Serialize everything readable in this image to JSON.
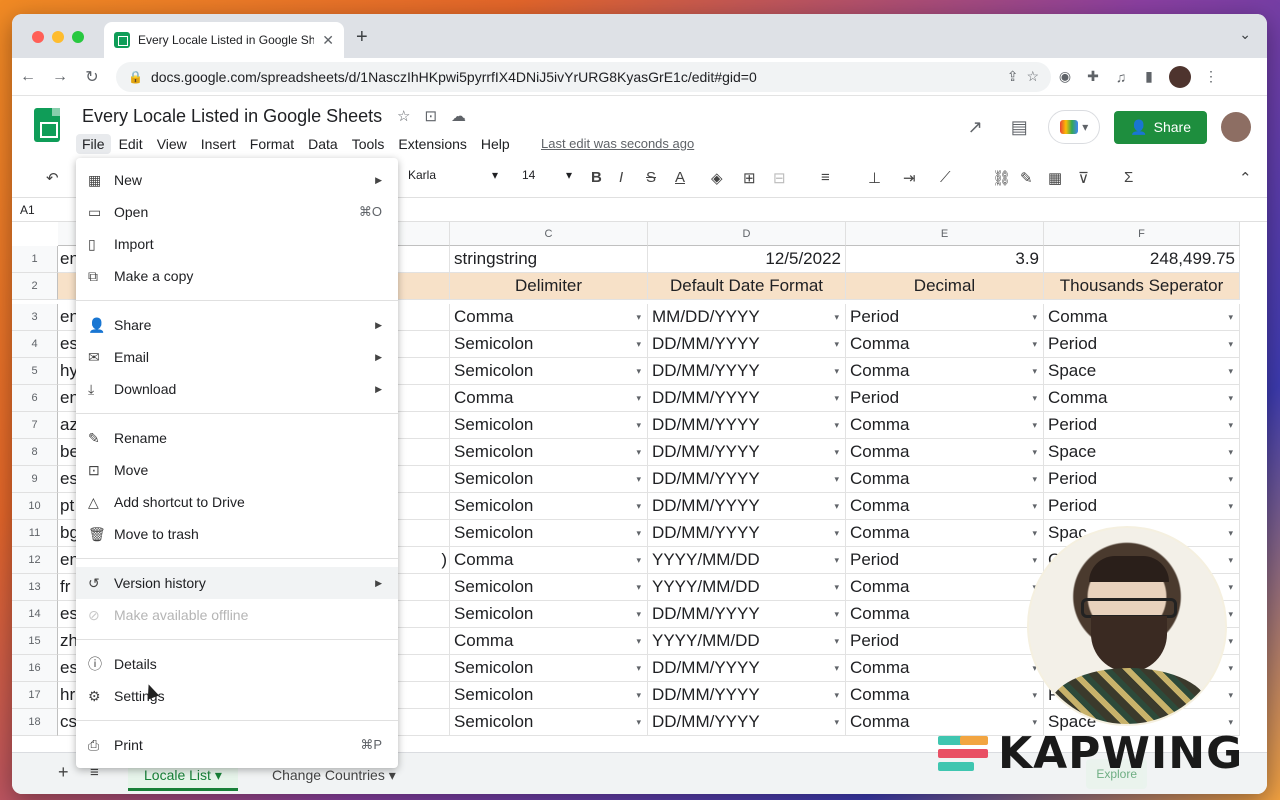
{
  "browser": {
    "tab_title": "Every Locale Listed in Google Sheets",
    "new_tab": "+",
    "url": "docs.google.com/spreadsheets/d/1NasczIhHKpwi5pyrrfIX4DNiJ5ivYrURG8KyasGrE1c/edit#gid=0"
  },
  "doc": {
    "title": "Every Locale Listed in Google Sheets",
    "menu": [
      "File",
      "Edit",
      "View",
      "Insert",
      "Format",
      "Data",
      "Tools",
      "Extensions",
      "Help"
    ],
    "last_edit": "Last edit was seconds ago",
    "share_label": "Share"
  },
  "toolbar": {
    "font": "Karla",
    "font_size": "14"
  },
  "formula_bar": {
    "cell_ref": "A1"
  },
  "grid": {
    "columns": [
      "C",
      "D",
      "E",
      "F"
    ],
    "row_numbers": [
      "1",
      "2",
      "3",
      "4",
      "5",
      "6",
      "7",
      "8",
      "9",
      "10",
      "11",
      "12",
      "13",
      "14",
      "15",
      "16",
      "17",
      "18"
    ],
    "col_a_partial": [
      "en",
      "",
      "en",
      "es",
      "hy",
      "en",
      "az",
      "be",
      "es",
      "pt",
      "bg",
      "en",
      "fr",
      "es",
      "zh",
      "es",
      "hr",
      "cs"
    ],
    "col_b_partial_row12": ")",
    "row1": {
      "c": "stringstring",
      "d": "12/5/2022",
      "e": "3.9",
      "f": "248,499.75"
    },
    "row2": {
      "c": "Delimiter",
      "d": "Default Date Format",
      "e": "Decimal",
      "f": "Thousands Seperator"
    },
    "rows": [
      {
        "c": "Comma",
        "d": "MM/DD/YYYY",
        "e": "Period",
        "f": "Comma"
      },
      {
        "c": "Semicolon",
        "d": "DD/MM/YYYY",
        "e": "Comma",
        "f": "Period"
      },
      {
        "c": "Semicolon",
        "d": "DD/MM/YYYY",
        "e": "Comma",
        "f": "Space"
      },
      {
        "c": "Comma",
        "d": "DD/MM/YYYY",
        "e": "Period",
        "f": "Comma"
      },
      {
        "c": "Semicolon",
        "d": "DD/MM/YYYY",
        "e": "Comma",
        "f": "Period"
      },
      {
        "c": "Semicolon",
        "d": "DD/MM/YYYY",
        "e": "Comma",
        "f": "Space"
      },
      {
        "c": "Semicolon",
        "d": "DD/MM/YYYY",
        "e": "Comma",
        "f": "Period"
      },
      {
        "c": "Semicolon",
        "d": "DD/MM/YYYY",
        "e": "Comma",
        "f": "Period"
      },
      {
        "c": "Semicolon",
        "d": "DD/MM/YYYY",
        "e": "Comma",
        "f": "Spac"
      },
      {
        "c": "Comma",
        "d": "YYYY/MM/DD",
        "e": "Period",
        "f": "C"
      },
      {
        "c": "Semicolon",
        "d": "YYYY/MM/DD",
        "e": "Comma",
        "f": ""
      },
      {
        "c": "Semicolon",
        "d": "DD/MM/YYYY",
        "e": "Comma",
        "f": ""
      },
      {
        "c": "Comma",
        "d": "YYYY/MM/DD",
        "e": "Period",
        "f": ""
      },
      {
        "c": "Semicolon",
        "d": "DD/MM/YYYY",
        "e": "Comma",
        "f": ""
      },
      {
        "c": "Semicolon",
        "d": "DD/MM/YYYY",
        "e": "Comma",
        "f": "P"
      },
      {
        "c": "Semicolon",
        "d": "DD/MM/YYYY",
        "e": "Comma",
        "f": "Space"
      }
    ]
  },
  "file_menu": {
    "new": "New",
    "open": "Open",
    "open_shortcut": "⌘O",
    "import": "Import",
    "make_copy": "Make a copy",
    "share": "Share",
    "email": "Email",
    "download": "Download",
    "rename": "Rename",
    "move": "Move",
    "add_shortcut": "Add shortcut to Drive",
    "move_trash": "Move to trash",
    "version_history": "Version history",
    "make_offline": "Make available offline",
    "details": "Details",
    "settings": "Settings",
    "print": "Print",
    "print_shortcut": "⌘P"
  },
  "sheet_tabs": {
    "active": "Locale List",
    "inactive": "Change Countries",
    "explore": "Explore"
  },
  "watermark": {
    "brand": "KAPWING",
    "colors": [
      "#3fc6b0",
      "#f2a541",
      "#e94f64",
      "#3fc6b0"
    ]
  }
}
